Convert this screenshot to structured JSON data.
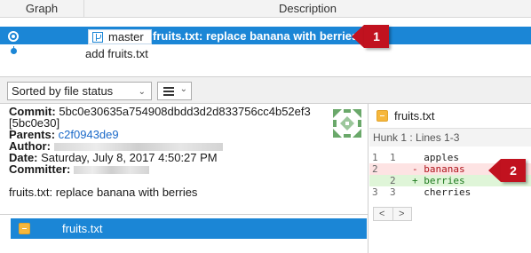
{
  "graph_table": {
    "headers": {
      "graph": "Graph",
      "description": "Description"
    },
    "rows": [
      {
        "branch": "master",
        "message": "fruits.txt: replace banana with berries",
        "selected": true
      },
      {
        "branch": "",
        "message": "add fruits.txt",
        "selected": false
      }
    ]
  },
  "callouts": {
    "one": "1",
    "two": "2"
  },
  "toolbar": {
    "sort_label": "Sorted by file status",
    "sort_chevron": "⌄",
    "view_chevron": "⌄"
  },
  "details": {
    "commit_label": "Commit:",
    "commit_hash": "5bc0e30635a754908dbdd3d2d833756cc4b52ef3",
    "commit_short": "[5bc0e30]",
    "parents_label": "Parents:",
    "parents_value": "c2f0943de9",
    "author_label": "Author:",
    "date_label": "Date:",
    "date_value": "Saturday, July 8, 2017 4:50:27 PM",
    "committer_label": "Committer:",
    "message": "fruits.txt: replace banana with berries"
  },
  "files": [
    {
      "name": "fruits.txt",
      "selected": true
    }
  ],
  "diff": {
    "file_name": "fruits.txt",
    "hunk_label": "Hunk 1 : Lines 1-3",
    "lines": [
      {
        "old": "1",
        "new": "1",
        "text": "  apples",
        "kind": "context"
      },
      {
        "old": "2",
        "new": "",
        "text": "- bananas",
        "kind": "del"
      },
      {
        "old": "",
        "new": "2",
        "text": "+ berries",
        "kind": "add"
      },
      {
        "old": "3",
        "new": "3",
        "text": "  cherries",
        "kind": "context"
      }
    ],
    "scroll_left": "<",
    "scroll_right": ">"
  },
  "colors": {
    "selection": "#1b86d6",
    "callout": "#c1121f",
    "deleted_bg": "#fde3e3",
    "added_bg": "#dff5d8",
    "file_icon": "#f6b73c",
    "link": "#1b6ac9"
  }
}
